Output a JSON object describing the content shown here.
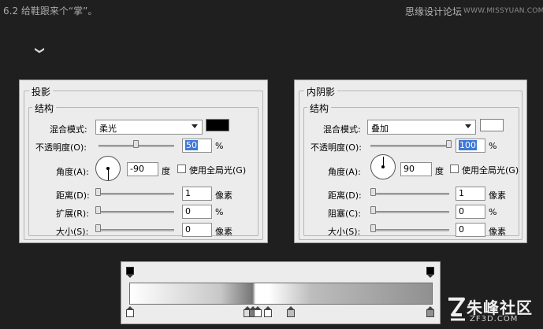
{
  "caption": "6.2 给鞋跟来个“掌”。",
  "watermark": {
    "site_cn": "思缘设计论坛",
    "site_en": "WWW.MISSYUAN.COM"
  },
  "decor_arrow": "❯",
  "drop_shadow": {
    "title": "投影",
    "group": "结构",
    "blend_label": "混合模式:",
    "blend_value": "柔光",
    "blend_color": "#000000",
    "opacity_label": "不透明度(O):",
    "opacity_value": "50",
    "opacity_unit": "%",
    "opacity_fraction": 0.5,
    "angle_label": "角度(A):",
    "angle_value": "-90",
    "angle_unit": "度",
    "global_light_label": "使用全局光(G)",
    "distance_label": "距离(D):",
    "distance_value": "1",
    "distance_unit": "像素",
    "spread_label": "扩展(R):",
    "spread_value": "0",
    "spread_unit": "%",
    "size_label": "大小(S):",
    "size_value": "0",
    "size_unit": "像素"
  },
  "inner_shadow": {
    "title": "内阴影",
    "group": "结构",
    "blend_label": "混合模式:",
    "blend_value": "叠加",
    "blend_color": "#ffffff",
    "opacity_label": "不透明度(O):",
    "opacity_value": "100",
    "opacity_unit": "%",
    "opacity_fraction": 1.0,
    "angle_label": "角度(A):",
    "angle_value": "90",
    "angle_unit": "度",
    "global_light_label": "使用全局光(G)",
    "distance_label": "距离(D):",
    "distance_value": "1",
    "distance_unit": "像素",
    "choke_label": "阻塞(C):",
    "choke_value": "0",
    "choke_unit": "%",
    "size_label": "大小(S):",
    "size_value": "0",
    "size_unit": "像素"
  },
  "gradient": {
    "colors": [
      "#ffffff",
      "#c8c8c8",
      "#7a7a7a",
      "#ffffff",
      "#bdbdbd",
      "#909090"
    ]
  },
  "logo": {
    "name_cn": "朱峰社区",
    "domain": "ZF3D.COM"
  }
}
